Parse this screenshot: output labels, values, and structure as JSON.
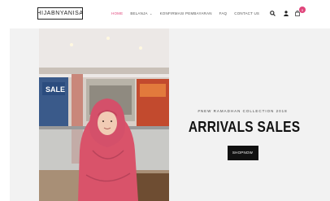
{
  "brand": {
    "logo_text": "HIJABNYANISA"
  },
  "nav": {
    "items": [
      {
        "label": "HOME",
        "active": true
      },
      {
        "label": "BELANJA",
        "has_dropdown": true
      },
      {
        "label": "KONFIRMASI PEMBAYARAN"
      },
      {
        "label": "FAQ"
      },
      {
        "label": "CONTACT US"
      }
    ],
    "dropdown_icon": "chevron-down-icon"
  },
  "header_icons": {
    "search": "search-icon",
    "account": "user-icon",
    "cart": "shopping-bag-icon",
    "cart_count": "0"
  },
  "hero": {
    "subtitle": "#NEW RAMADHAN COLLECTION 2018",
    "title": "ARRIVALS SALES",
    "button_label": "SHOPNOW",
    "photo_sign": "SALE"
  },
  "colors": {
    "accent": "#e0457b",
    "hero_background": "#f2f2f2",
    "button_background": "#111111",
    "hijab": "#d9536a"
  }
}
